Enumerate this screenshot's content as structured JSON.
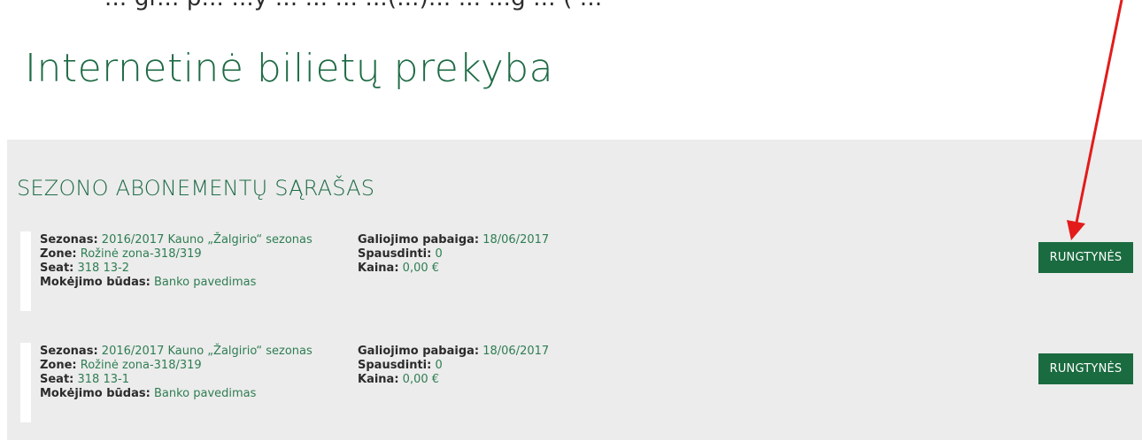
{
  "top_text": "... gr... p... ...y ... ... ... ...(...)... ... ...g ... ( ...",
  "page_title": "Internetinė bilietų prekyba",
  "panel_title": "SEZONO ABONEMENTŲ SĄRAŠAS",
  "colors": {
    "brand_green": "#1a6b40",
    "accent_red": "#e31b1b",
    "panel_bg": "#ececec"
  },
  "tickets": [
    {
      "season_label": "Sezonas:",
      "season": "2016/2017 Kauno „Žalgirio“ sezonas",
      "zone_label": "Zone:",
      "zone": "Rožinė zona-318/319",
      "seat_label": "Seat:",
      "seat": "318 13-2",
      "payment_label": "Mokėjimo būdas:",
      "payment": "Banko pavedimas",
      "expiry_label": "Galiojimo pabaiga:",
      "expiry": "18/06/2017",
      "print_label": "Spausdinti:",
      "print": "0",
      "price_label": "Kaina:",
      "price": "0,00 €",
      "button_label": "RUNGTYNĖS"
    },
    {
      "season_label": "Sezonas:",
      "season": "2016/2017 Kauno „Žalgirio“ sezonas",
      "zone_label": "Zone:",
      "zone": "Rožinė zona-318/319",
      "seat_label": "Seat:",
      "seat": "318 13-1",
      "payment_label": "Mokėjimo būdas:",
      "payment": "Banko pavedimas",
      "expiry_label": "Galiojimo pabaiga:",
      "expiry": "18/06/2017",
      "print_label": "Spausdinti:",
      "print": "0",
      "price_label": "Kaina:",
      "price": "0,00 €",
      "button_label": "RUNGTYNĖS"
    }
  ]
}
